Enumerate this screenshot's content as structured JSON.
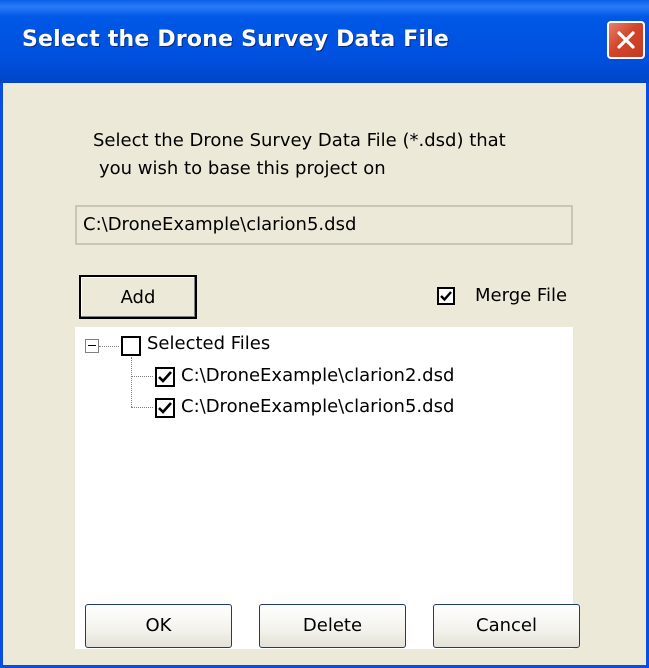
{
  "window": {
    "title": "Select the Drone Survey Data File"
  },
  "dialog": {
    "prompt_line1": "Select the Drone Survey Data File (*.dsd) that",
    "prompt_line2": "you wish to base this project on",
    "path_value": "C:\\DroneExample\\clarion5.dsd",
    "add_label": "Add",
    "merge_label": "Merge File",
    "merge_checked": true
  },
  "tree": {
    "root_label": "Selected Files",
    "root_checked": false,
    "items": [
      {
        "label": "C:\\DroneExample\\clarion2.dsd",
        "checked": true
      },
      {
        "label": "C:\\DroneExample\\clarion5.dsd",
        "checked": true
      }
    ]
  },
  "buttons": {
    "ok": "OK",
    "delete": "Delete",
    "cancel": "Cancel"
  },
  "colors": {
    "titlebar": "#0058e6",
    "dialog_bg": "#ece9d8",
    "close": "#d3452c"
  },
  "icons": {
    "close": "close-icon",
    "check": "check-icon",
    "expander": "minus-expander-icon"
  }
}
